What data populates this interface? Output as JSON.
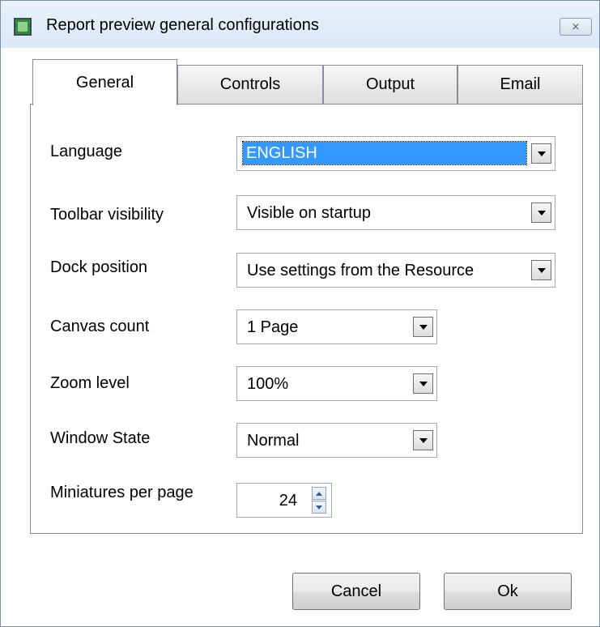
{
  "window": {
    "title": "Report preview general configurations",
    "close_glyph": "⨯",
    "icon": "app-icon"
  },
  "tabs": [
    {
      "label": "General",
      "active": true
    },
    {
      "label": "Controls",
      "active": false
    },
    {
      "label": "Output",
      "active": false
    },
    {
      "label": "Email",
      "active": false
    }
  ],
  "fields": {
    "language": {
      "label": "Language",
      "value": "ENGLISH"
    },
    "toolbar_visibility": {
      "label": "Toolbar visibility",
      "value": "Visible on startup"
    },
    "dock_position": {
      "label": "Dock position",
      "value": "Use settings from the Resource"
    },
    "canvas_count": {
      "label": "Canvas count",
      "value": "1 Page"
    },
    "zoom_level": {
      "label": "Zoom level",
      "value": "100%"
    },
    "window_state": {
      "label": "Window State",
      "value": "Normal"
    },
    "miniatures_per_page": {
      "label": "Miniatures per page",
      "value": "24"
    }
  },
  "buttons": {
    "cancel": "Cancel",
    "ok": "Ok"
  },
  "colors": {
    "selection": "#3399ff",
    "title_bar": "#dbe8f7"
  }
}
